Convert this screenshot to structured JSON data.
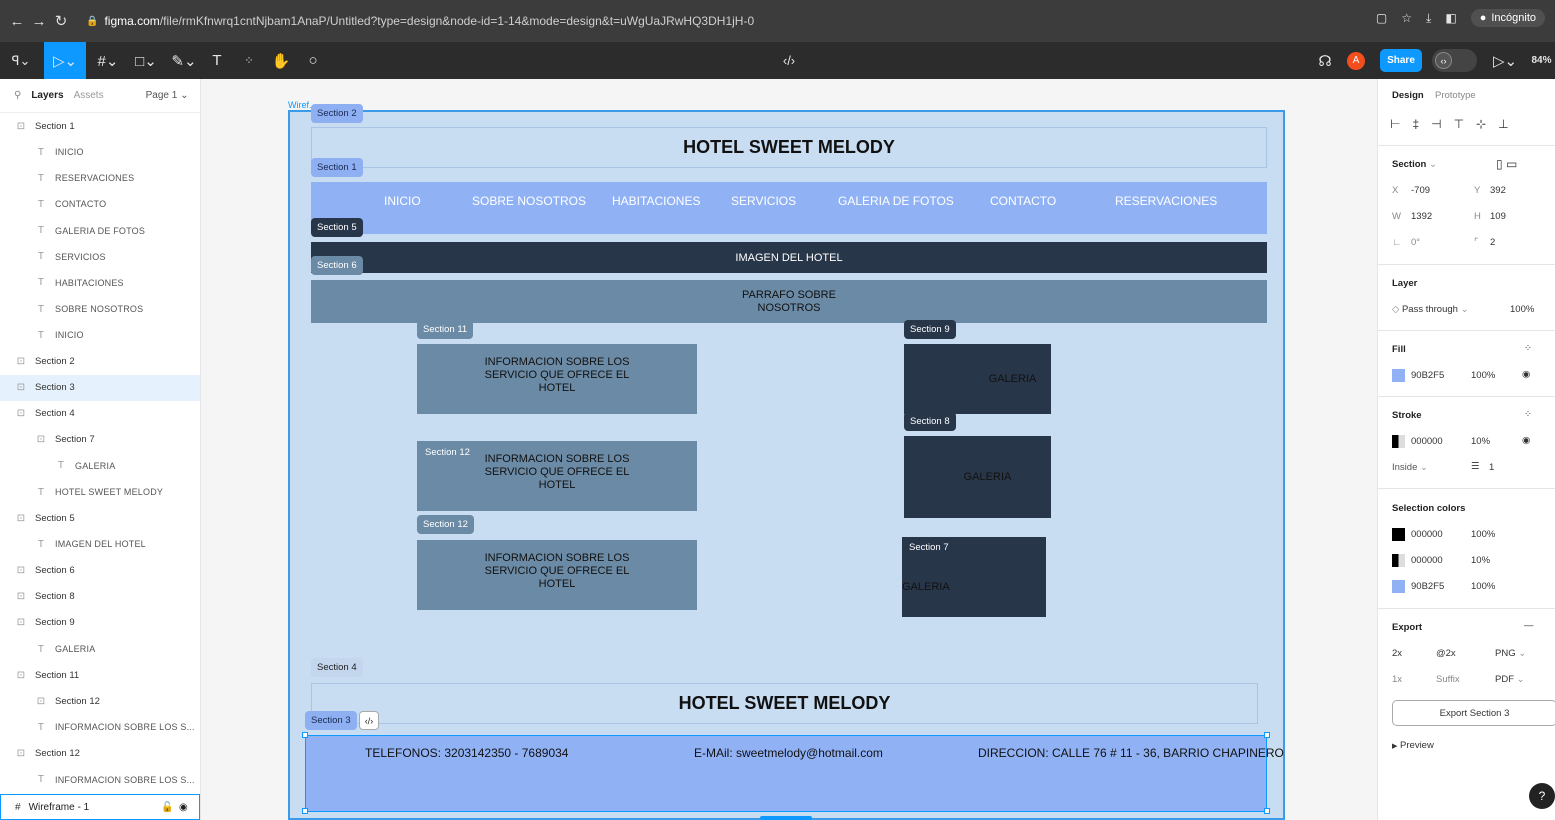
{
  "browser": {
    "url_host": "figma.com",
    "url_path": "/file/rmKfnwrq1cntNjbam1AnaP/Untitled?type=design&node-id=1-14&mode=design&t=uWgUaJRwHQ3DH1jH-0",
    "incognito_label": "Incógnito"
  },
  "toolbar": {
    "share_label": "Share",
    "zoom": "84%",
    "text_tool": "T"
  },
  "left_panel": {
    "tabs": [
      "Layers",
      "Assets"
    ],
    "page": "Page 1",
    "layers": [
      {
        "label": "Section 1",
        "kind": "section",
        "indent": 0,
        "selected": false
      },
      {
        "label": "INICIO",
        "kind": "text",
        "indent": 1,
        "selected": false
      },
      {
        "label": "RESERVACIONES",
        "kind": "text",
        "indent": 1,
        "selected": false
      },
      {
        "label": "CONTACTO",
        "kind": "text",
        "indent": 1,
        "selected": false
      },
      {
        "label": "GALERIA DE FOTOS",
        "kind": "text",
        "indent": 1,
        "selected": false
      },
      {
        "label": "SERVICIOS",
        "kind": "text",
        "indent": 1,
        "selected": false
      },
      {
        "label": "HABITACIONES",
        "kind": "text",
        "indent": 1,
        "selected": false
      },
      {
        "label": "SOBRE NOSOTROS",
        "kind": "text",
        "indent": 1,
        "selected": false
      },
      {
        "label": "INICIO",
        "kind": "text",
        "indent": 1,
        "selected": false
      },
      {
        "label": "Section 2",
        "kind": "section",
        "indent": 0,
        "selected": false
      },
      {
        "label": "Section 3",
        "kind": "section",
        "indent": 0,
        "selected": true
      },
      {
        "label": "Section 4",
        "kind": "section",
        "indent": 0,
        "selected": false
      },
      {
        "label": "Section 7",
        "kind": "section",
        "indent": 1,
        "selected": false
      },
      {
        "label": "GALERIA",
        "kind": "text",
        "indent": 2,
        "selected": false
      },
      {
        "label": "HOTEL SWEET MELODY",
        "kind": "text",
        "indent": 1,
        "selected": false
      },
      {
        "label": "Section 5",
        "kind": "section",
        "indent": 0,
        "selected": false
      },
      {
        "label": "IMAGEN DEL HOTEL",
        "kind": "text",
        "indent": 1,
        "selected": false
      },
      {
        "label": "Section 6",
        "kind": "section",
        "indent": 0,
        "selected": false
      },
      {
        "label": "Section 8",
        "kind": "section",
        "indent": 0,
        "selected": false
      },
      {
        "label": "Section 9",
        "kind": "section",
        "indent": 0,
        "selected": false
      },
      {
        "label": "GALERIA",
        "kind": "text",
        "indent": 1,
        "selected": false
      },
      {
        "label": "Section 11",
        "kind": "section",
        "indent": 0,
        "selected": false
      },
      {
        "label": "Section 12",
        "kind": "section",
        "indent": 1,
        "selected": false
      },
      {
        "label": "INFORMACION SOBRE LOS S...",
        "kind": "text",
        "indent": 1,
        "selected": false
      },
      {
        "label": "Section 12",
        "kind": "section",
        "indent": 0,
        "selected": false
      },
      {
        "label": "INFORMACION SOBRE LOS S...",
        "kind": "text",
        "indent": 1,
        "selected": false
      }
    ],
    "wireframe": "Wireframe - 1"
  },
  "canvas": {
    "frame_label": "Wiref...",
    "title": "HOTEL SWEET MELODY",
    "nav_items": [
      "INICIO",
      "SOBRE NOSOTROS",
      "HABITACIONES",
      "SERVICIOS",
      "GALERIA DE FOTOS",
      "CONTACTO",
      "RESERVACIONES"
    ],
    "image_label": "IMAGEN DEL HOTEL",
    "about_label": "PARRAFO SOBRE\nNOSOTROS",
    "info_label": "INFORMACION SOBRE LOS\nSERVICIO QUE OFRECE EL\nHOTEL",
    "gallery_label": "GALERIA",
    "footer_title": "HOTEL SWEET MELODY",
    "phones": "TELEFONOS: 3203142350 - 7689034",
    "email": "E-MAil: sweetmelody@hotmail.com",
    "address": "DIRECCION: CALLE 76 # 11 - 36, BARRIO CHAPINERO",
    "tags": {
      "s1": "Section 1",
      "s2": "Section 2",
      "s3": "Section 3",
      "s4": "Section 4",
      "s5": "Section 5",
      "s6": "Section 6",
      "s7": "Section 7",
      "s8": "Section 8",
      "s9": "Section 9",
      "s11": "Section 11",
      "s12": "Section 12"
    }
  },
  "right_panel": {
    "tabs": [
      "Design",
      "Prototype"
    ],
    "section_label": "Section",
    "x_label": "X",
    "x": "-709",
    "y_label": "Y",
    "y": "392",
    "w_label": "W",
    "w": "1392",
    "h_label": "H",
    "h": "109",
    "rotation": "0°",
    "radius": "2",
    "layer_label": "Layer",
    "blend": "Pass through",
    "layer_opacity": "100%",
    "fill_label": "Fill",
    "fill_hex": "90B2F5",
    "fill_opacity": "100%",
    "stroke_label": "Stroke",
    "stroke_hex": "000000",
    "stroke_opacity": "10%",
    "stroke_position": "Inside",
    "stroke_weight": "1",
    "selection_colors_label": "Selection colors",
    "selection_colors": [
      {
        "hex": "000000",
        "opacity": "100%"
      },
      {
        "hex": "000000",
        "opacity": "10%"
      },
      {
        "hex": "90B2F5",
        "opacity": "100%"
      }
    ],
    "export_label": "Export",
    "export_scale": "2x",
    "export_suffix_val": "@2x",
    "export_format": "PNG",
    "export_scale2": "1x",
    "export_suffix_placeholder": "Suffix",
    "export_format2": "PDF",
    "export_button": "Export Section 3",
    "preview_label": "Preview",
    "help": "?"
  },
  "colors": {
    "light_blue": "#90B2F5",
    "frame_bg": "#c8dcf2",
    "dark_navy": "#28364a",
    "slate": "#6b8aa5",
    "figma_blue": "#0d99ff"
  }
}
